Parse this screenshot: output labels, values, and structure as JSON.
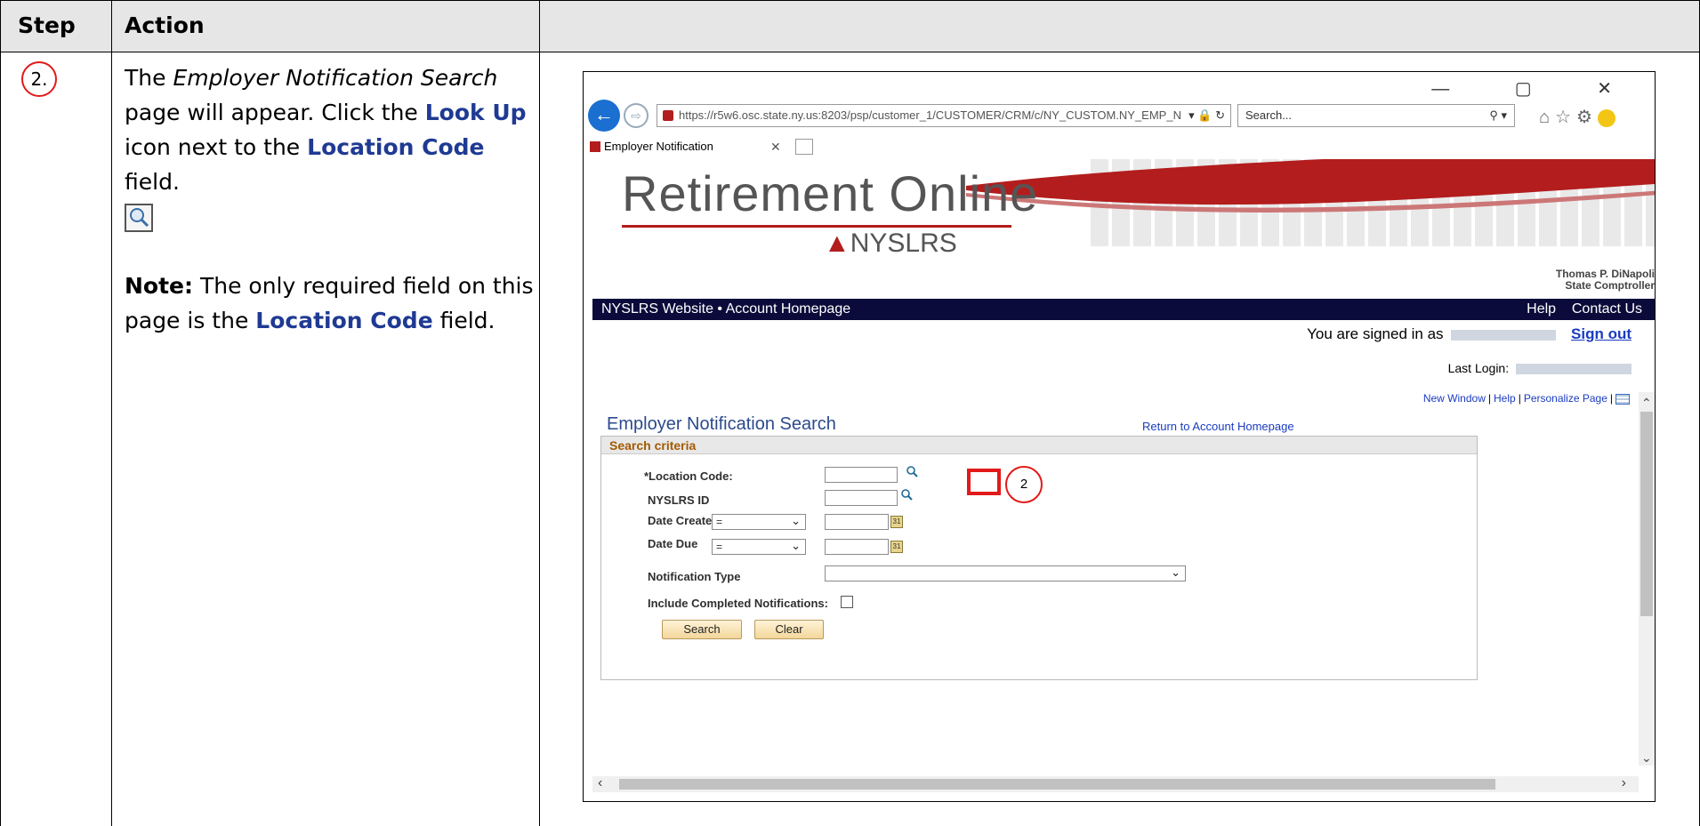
{
  "table": {
    "header_step": "Step",
    "header_action": "Action",
    "step_number": "2."
  },
  "action": {
    "p1_a": "The ",
    "p1_italic": "Employer Notification Search",
    "p1_b": " page will appear.  Click the ",
    "p1_kw1": "Look Up",
    "p1_c": " icon next to the ",
    "p1_kw2": "Location Code",
    "p1_d": " field.",
    "note_label": "Note:",
    "note_a": " The only required field on this page is the ",
    "note_kw": "Location Code",
    "note_b": " field."
  },
  "browser": {
    "url": "https://r5w6.osc.state.ny.us:8203/psp/customer_1/CUSTOMER/CRM/c/NY_CUSTOM.NY_EMP_N",
    "url_controls": "▾ 🔒 ↻",
    "search_placeholder": "Search...",
    "tab_title": "Employer Notification",
    "window_controls": "—  ▢  ✕"
  },
  "banner": {
    "logo": "Retirement Online",
    "sub_logo": "NYSLRS",
    "comptroller_name": "Thomas P. DiNapoli",
    "comptroller_title": "State Comptroller"
  },
  "nav": {
    "left": "NYSLRS Website  •  Account Homepage",
    "help": "Help",
    "contact": "Contact Us"
  },
  "session": {
    "signed_in": "You are signed in as",
    "sign_out": "Sign out",
    "last_login": "Last Login:"
  },
  "pagelinks": {
    "new_window": "New Window",
    "help": "Help",
    "personalize": "Personalize Page"
  },
  "page": {
    "title": "Employer Notification Search",
    "return_link": "Return to Account Homepage",
    "section": "Search criteria",
    "location_code": "*Location Code:",
    "nyslrs_id": "NYSLRS ID",
    "date_created": "Date Created",
    "date_created_op": "=",
    "date_due": "Date Due",
    "date_due_op": "=",
    "notification_type": "Notification Type",
    "include_completed": "Include Completed Notifications:",
    "search_btn": "Search",
    "clear_btn": "Clear"
  },
  "callout_number": "2",
  "colors": {
    "nav_bg": "#0b0b3b",
    "brand_red": "#b31d1d",
    "link_blue": "#1a3cc0",
    "highlight_red": "#e21a1a"
  }
}
